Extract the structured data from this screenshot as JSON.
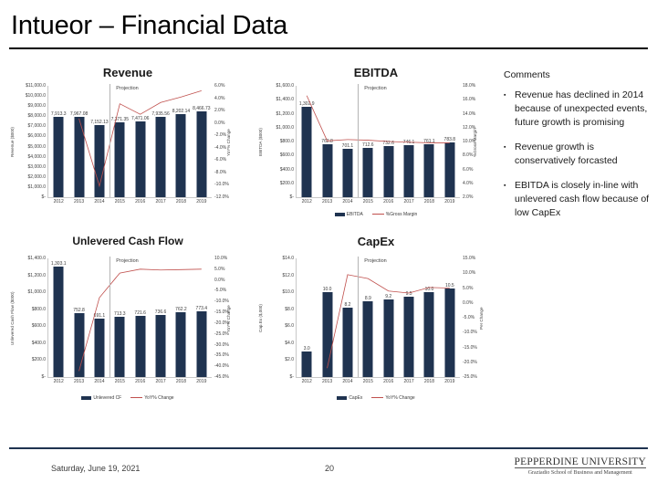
{
  "slide": {
    "title": "Intueor – Financial Data"
  },
  "comments": {
    "heading": "Comments",
    "bullet_mark": "▪",
    "items": [
      "Revenue has declined in 2014 because of unexpected events, future growth is promising",
      "Revenue growth is conservatively forcasted",
      "EBITDA is closely in-line with unlevered cash flow because of low CapEx"
    ]
  },
  "footer": {
    "date": "Saturday, June 19, 2021",
    "page": "20",
    "logo_main": "PEPPERDINE UNIVERSITY",
    "logo_sub": "Graziadio School of Business and Management"
  },
  "colors": {
    "bar": "#1f3350",
    "line": "#c0504d",
    "axis": "#c8c8c8",
    "rule": "#1f3350"
  },
  "chart_data": [
    {
      "type": "bar",
      "id": "revenue",
      "title": "Revenue",
      "categories": [
        "2012",
        "2013",
        "2014",
        "2015",
        "2016",
        "2017",
        "2018",
        "2019"
      ],
      "ylabel": "Revenue ($000)",
      "y2label": "YoY% Change",
      "ylim": [
        0,
        11000
      ],
      "yticks": [
        "$11,000.0",
        "$10,000.0",
        "$9,000.0",
        "$8,000.0",
        "$7,000.0",
        "$6,000.0",
        "$5,000.0",
        "$4,000.0",
        "$3,000.0",
        "$2,000.0",
        "$1,000.0",
        "$-"
      ],
      "y2lim": [
        -12,
        6
      ],
      "y2ticks": [
        "6.0%",
        "4.0%",
        "2.0%",
        "0.0%",
        "-2.0%",
        "-4.0%",
        "-6.0%",
        "-8.0%",
        "-10.0%",
        "-12.0%"
      ],
      "series": [
        {
          "name": "Revenue",
          "kind": "bar",
          "values": [
            7913.3,
            7967.0,
            7152.1,
            7371.3,
            7471.0,
            7935.5,
            8202.1,
            8466.7
          ],
          "labels": [
            "7,913.3",
            "7,967.08",
            "7,152.13",
            "7,371.35",
            "7,471.06",
            "7,935.56",
            "8,202.14",
            "8,466.73"
          ]
        },
        {
          "name": "YoY% Change",
          "kind": "line",
          "values": [
            null,
            0.7,
            -10.2,
            3.1,
            1.4,
            3.3,
            4.2,
            5.2
          ]
        }
      ],
      "projection_label": "Projection",
      "projection_after_index": 2,
      "legend": [
        {
          "name": "Revenue",
          "kind": "bar"
        },
        {
          "name": "YoY% Change",
          "kind": "line"
        }
      ],
      "legend_visible": false
    },
    {
      "type": "bar",
      "id": "ebitda",
      "title": "EBITDA",
      "categories": [
        "2012",
        "2013",
        "2014",
        "2015",
        "2016",
        "2017",
        "2018",
        "2019"
      ],
      "ylabel": "EBITDA ($000)",
      "y2label": "%Gross Margin",
      "ylim": [
        0,
        1600
      ],
      "yticks": [
        "$1,600.0",
        "$1,400.0",
        "$1,200.0",
        "$1,000.0",
        "$800.0",
        "$600.0",
        "$400.0",
        "$200.0",
        "$-"
      ],
      "y2lim": [
        1,
        18
      ],
      "y2ticks": [
        "18.0%",
        "16.0%",
        "14.0%",
        "12.0%",
        "10.0%",
        "8.0%",
        "6.0%",
        "4.0%",
        "2.0%"
      ],
      "series": [
        {
          "name": "EBITDA",
          "kind": "bar",
          "values": [
            1302.9,
            762.8,
            701.1,
            712.6,
            732.6,
            746.1,
            761.1,
            783.8
          ],
          "labels": [
            "1,302.9",
            "762.8",
            "701.1",
            "712.6",
            "732.6",
            "746.1",
            "761.1",
            "783.8"
          ]
        },
        {
          "name": "%Gross Margin",
          "kind": "line",
          "values": [
            16.5,
            9.6,
            9.8,
            9.7,
            9.5,
            9.4,
            9.3,
            9.3
          ]
        }
      ],
      "projection_label": "Projection",
      "projection_after_index": 2,
      "legend": [
        {
          "name": "EBITDA",
          "kind": "bar"
        },
        {
          "name": "%Gross Margin",
          "kind": "line"
        }
      ],
      "legend_visible": true
    },
    {
      "type": "bar",
      "id": "unlevered-cash-flow",
      "title": "Unlevered Cash Flow",
      "categories": [
        "2012",
        "2013",
        "2014",
        "2015",
        "2016",
        "2017",
        "2018",
        "2019"
      ],
      "ylabel": "Unlevered Cash Flow ($000)",
      "y2label": "YoY% Change",
      "ylim": [
        0,
        1400
      ],
      "yticks": [
        "$1,400.0",
        "$1,200.0",
        "$1,000.0",
        "$800.0",
        "$600.0",
        "$400.0",
        "$200.0",
        "$-"
      ],
      "y2lim": [
        -45,
        10
      ],
      "y2ticks": [
        "10.0%",
        "5.0%",
        "0.0%",
        "-5.0%",
        "-10.0%",
        "-15.0%",
        "-20.0%",
        "-25.0%",
        "-30.0%",
        "-35.0%",
        "-40.0%",
        "-45.0%"
      ],
      "series": [
        {
          "name": "Unlevered CF",
          "kind": "bar",
          "values": [
            1303.1,
            752.8,
            691.1,
            713.3,
            721.6,
            736.6,
            762.2,
            773.4
          ],
          "labels": [
            "1,303.1",
            "752.8",
            "691.1",
            "713.3",
            "721.6",
            "736.6",
            "762.2",
            "773.4"
          ]
        },
        {
          "name": "YoY% Change",
          "kind": "line",
          "values": [
            null,
            -42.2,
            -8.2,
            3.2,
            5.0,
            4.6,
            4.8,
            5.0
          ]
        }
      ],
      "projection_label": "Projection",
      "projection_after_index": 2,
      "legend": [
        {
          "name": "Unlevered CF",
          "kind": "bar"
        },
        {
          "name": "YoY% Change",
          "kind": "line"
        }
      ],
      "legend_visible": true
    },
    {
      "type": "bar",
      "id": "capex",
      "title": "CapEx",
      "categories": [
        "2012",
        "2013",
        "2014",
        "2015",
        "2016",
        "2017",
        "2018",
        "2019"
      ],
      "ylabel": "Cap.Ex ($,000)",
      "y2label": "Per Change",
      "ylim": [
        0,
        14
      ],
      "yticks": [
        "$14.0",
        "$12.0",
        "$10.0",
        "$8.0",
        "$6.0",
        "$4.0",
        "$2.0",
        "$-"
      ],
      "y2lim": [
        -25,
        15
      ],
      "y2ticks": [
        "15.0%",
        "10.0%",
        "5.0%",
        "0.0%",
        "-5.0%",
        "-10.0%",
        "-15.0%",
        "-20.0%",
        "-25.0%"
      ],
      "series": [
        {
          "name": "CapEx",
          "kind": "bar",
          "values": [
            3.0,
            10.0,
            8.2,
            8.9,
            9.2,
            9.5,
            10.0,
            10.5
          ],
          "labels": [
            "3.0",
            "10.0",
            "8.2",
            "8.9",
            "9.2",
            "9.5",
            "10.0",
            "10.5"
          ]
        },
        {
          "name": "YoY% Change",
          "kind": "line",
          "values": [
            null,
            -22.0,
            9.5,
            8.2,
            4.0,
            3.3,
            5.2,
            5.0
          ]
        }
      ],
      "projection_label": "Projection",
      "projection_after_index": 2,
      "legend": [
        {
          "name": "CapEx",
          "kind": "bar"
        },
        {
          "name": "YoY% Change",
          "kind": "line"
        }
      ],
      "legend_visible": true
    }
  ]
}
